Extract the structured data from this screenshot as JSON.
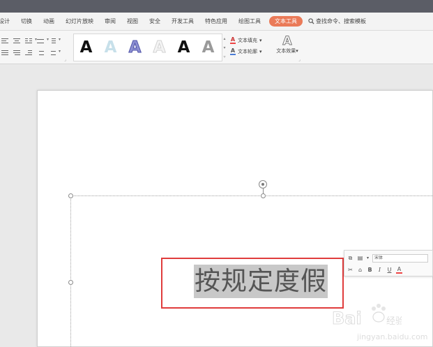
{
  "menu": {
    "items": [
      "设计",
      "切换",
      "动画",
      "幻灯片放映",
      "审阅",
      "视图",
      "安全",
      "开发工具",
      "特色应用",
      "绘图工具"
    ],
    "active_tab": "文本工具",
    "search_label": "查找命令、搜索模板"
  },
  "ribbon": {
    "art_style_letter": "A",
    "text_fill_label": "文本填充",
    "text_outline_label": "文本轮廓",
    "text_effects_label": "文本效果",
    "dropdown_glyph": "▾"
  },
  "slide": {
    "selected_text": "按规定度假"
  },
  "mini_toolbar": {
    "font_name": "宋体",
    "bold": "B",
    "italic": "I",
    "underline": "U",
    "font_color": "A"
  },
  "watermark": {
    "text": "Bai du 经验",
    "url": "jingyan.baidu.com"
  },
  "colors": {
    "title_bar": "#5b5d66",
    "active_tab": "#ea7a58",
    "selection_highlight": "#c8c8c8",
    "annotation_box": "#e03c3c"
  }
}
